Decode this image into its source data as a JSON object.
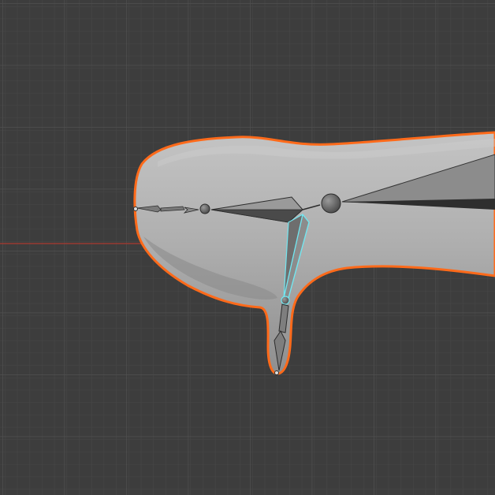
{
  "viewport": {
    "background": "#3d3d3d",
    "grid_minor_color": "#464646",
    "grid_major_color": "#4e4e4e",
    "x_axis_color": "#9a3a32"
  },
  "mesh": {
    "fill": "#a9a9a9",
    "outline_color": "#ff6a1a",
    "state": "selected"
  },
  "armature": {
    "bone_color": "#3a3a3a",
    "bone_face": "#8c8c8c",
    "active_bone_color": "#72e6f0"
  }
}
